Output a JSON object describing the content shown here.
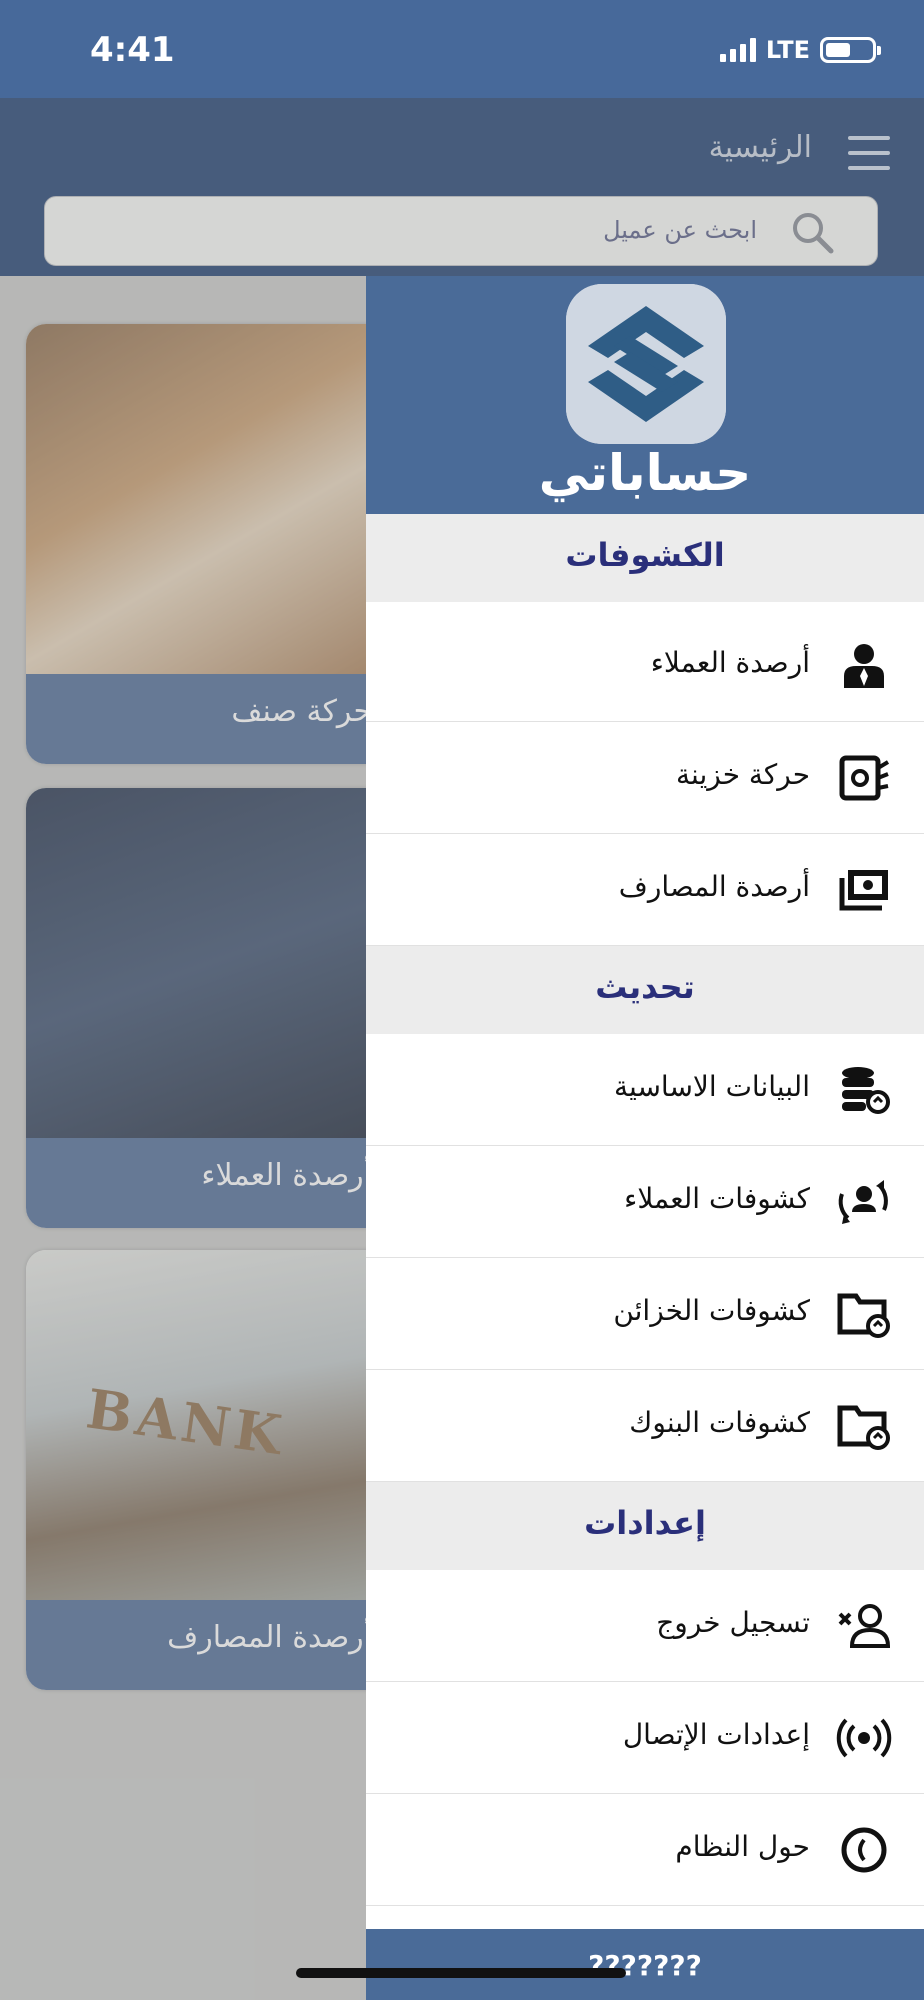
{
  "status_bar": {
    "time": "4:41",
    "network": "LTE"
  },
  "header": {
    "title": "الرئيسية",
    "search_placeholder": "ابحث عن عميل"
  },
  "cards": [
    {
      "label": "حركة صنف"
    },
    {
      "label": "أرصدة العملاء"
    },
    {
      "label": "أرصدة المصارف",
      "sign_text": "BANK"
    }
  ],
  "drawer": {
    "logo_text": "حساباتي",
    "sections": [
      {
        "title": "الكشوفات",
        "items": [
          {
            "label": "أرصدة العملاء",
            "icon": "customer-icon"
          },
          {
            "label": "حركة خزينة",
            "icon": "treasury-icon"
          },
          {
            "label": "أرصدة المصارف",
            "icon": "cash-icon"
          }
        ]
      },
      {
        "title": "تحديث",
        "items": [
          {
            "label": "البيانات الاساسية",
            "icon": "database-sync-icon"
          },
          {
            "label": "كشوفات العملاء",
            "icon": "user-sync-icon"
          },
          {
            "label": "كشوفات الخزائن",
            "icon": "folder-sync-icon"
          },
          {
            "label": "كشوفات البنوك",
            "icon": "folder-sync-icon"
          }
        ]
      },
      {
        "title": "إعدادات",
        "items": [
          {
            "label": "تسجيل خروج",
            "icon": "user-remove-icon"
          },
          {
            "label": "إعدادات الإتصال",
            "icon": "broadcast-icon"
          },
          {
            "label": "حول النظام",
            "icon": "info-circle-icon"
          }
        ]
      }
    ],
    "footer": "???????"
  },
  "colors": {
    "primary": "#4a6b98",
    "header": "#475c7c",
    "section_text": "#2a2f7a"
  }
}
